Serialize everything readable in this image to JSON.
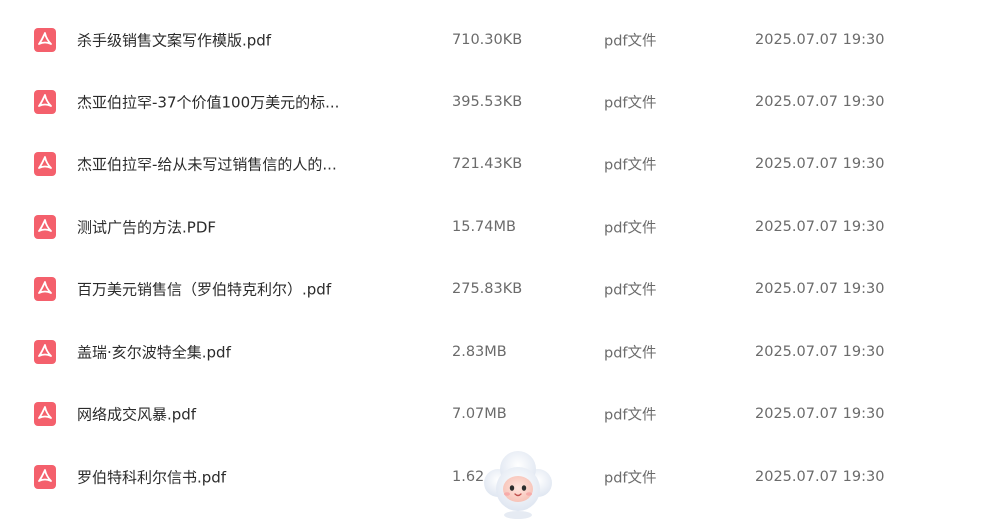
{
  "files": [
    {
      "name": "杀手级销售文案写作模版.pdf",
      "size": "710.30KB",
      "type": "pdf文件",
      "date": "2025.07.07 19:30"
    },
    {
      "name": "杰亚伯拉罕-37个价值100万美元的标...",
      "size": "395.53KB",
      "type": "pdf文件",
      "date": "2025.07.07 19:30"
    },
    {
      "name": "杰亚伯拉罕-给从未写过销售信的人的...",
      "size": "721.43KB",
      "type": "pdf文件",
      "date": "2025.07.07 19:30"
    },
    {
      "name": "测试广告的方法.PDF",
      "size": "15.74MB",
      "type": "pdf文件",
      "date": "2025.07.07 19:30"
    },
    {
      "name": "百万美元销售信（罗伯特克利尔）.pdf",
      "size": "275.83KB",
      "type": "pdf文件",
      "date": "2025.07.07 19:30"
    },
    {
      "name": "盖瑞·亥尔波特全集.pdf",
      "size": "2.83MB",
      "type": "pdf文件",
      "date": "2025.07.07 19:30"
    },
    {
      "name": "网络成交风暴.pdf",
      "size": "7.07MB",
      "type": "pdf文件",
      "date": "2025.07.07 19:30"
    },
    {
      "name": "罗伯特科利尔信书.pdf",
      "size": "1.62",
      "type": "pdf文件",
      "date": "2025.07.07 19:30"
    }
  ],
  "icons": {
    "file_icon": "pdf-file-icon",
    "assistant": "cloud-mascot-icon"
  },
  "colors": {
    "pdf_icon": "#f4606c",
    "text_primary": "#2b2b2b",
    "text_secondary": "#6b6b6b"
  }
}
